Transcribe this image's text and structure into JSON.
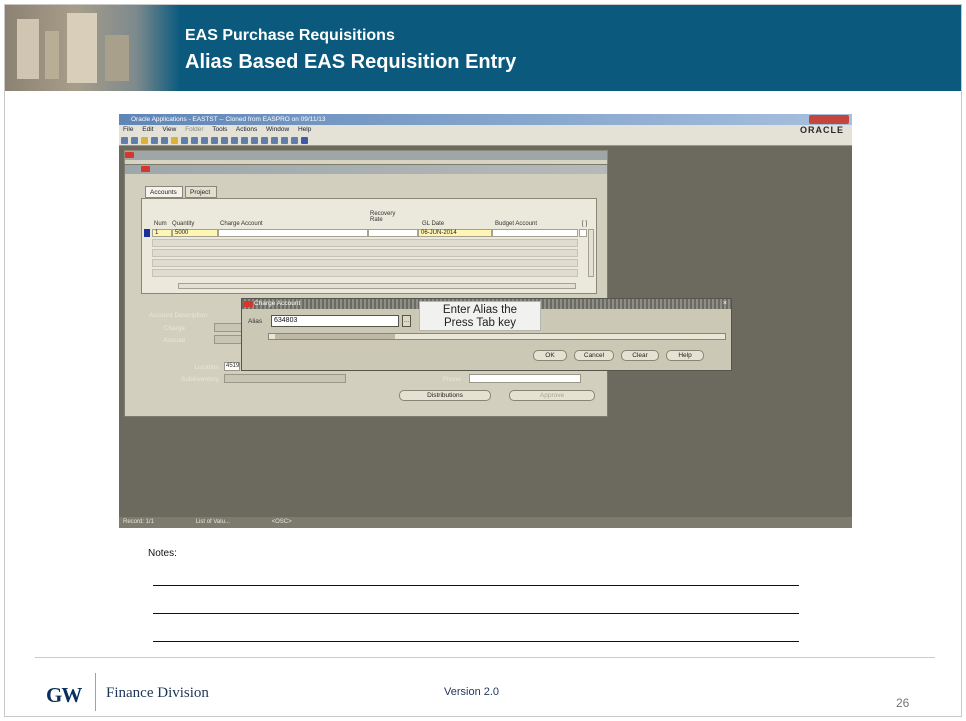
{
  "header": {
    "title_line1": "EAS Purchase Requisitions",
    "title_line2": "Alias Based EAS Requisition Entry",
    "band_color": "#0b5a7e"
  },
  "oracle_window": {
    "titlebar": "Oracle Applications - EASTST -- Cloned from EASPRO on 09/11/13",
    "menu": [
      "File",
      "Edit",
      "View",
      "Folder",
      "Tools",
      "Actions",
      "Window",
      "Help"
    ],
    "logo": "ORACLE",
    "tabs": [
      "Accounts",
      "Project"
    ],
    "columns": {
      "num": "Num",
      "quantity": "Quantity",
      "charge_account": "Charge Account",
      "recovery_rate": "Recovery\nRate",
      "gl_date": "GL Date",
      "budget_account": "Budget Account",
      "misc": "[ ]"
    },
    "row1": {
      "num": "1",
      "quantity": "5000",
      "gl_date": "06-JUN-2014"
    },
    "fields": {
      "account_description": "Account Description",
      "charge": "Charge",
      "accrual": "Accrual",
      "location": "Location",
      "location_value": "4519",
      "subinventory": "Subinventory",
      "phone": "Phone"
    },
    "buttons": {
      "distributions": "Distributions",
      "approve": "Approve"
    },
    "status_bar": [
      "Record: 1/1",
      "List of Valu...",
      "<OSC>"
    ]
  },
  "charge_account_dialog": {
    "title": "Charge Account",
    "alias_label": "Alias",
    "alias_value": "634803",
    "lov_button": "...",
    "close": "×",
    "buttons": {
      "ok": "OK",
      "cancel": "Cancel",
      "clear": "Clear",
      "help": "Help"
    }
  },
  "callout": {
    "line1": "Enter Alias the",
    "line2": "Press Tab key"
  },
  "notes": {
    "label": "Notes:"
  },
  "footer": {
    "logo": "GW",
    "division": "Finance Division",
    "version": "Version 2.0",
    "page": "26"
  }
}
